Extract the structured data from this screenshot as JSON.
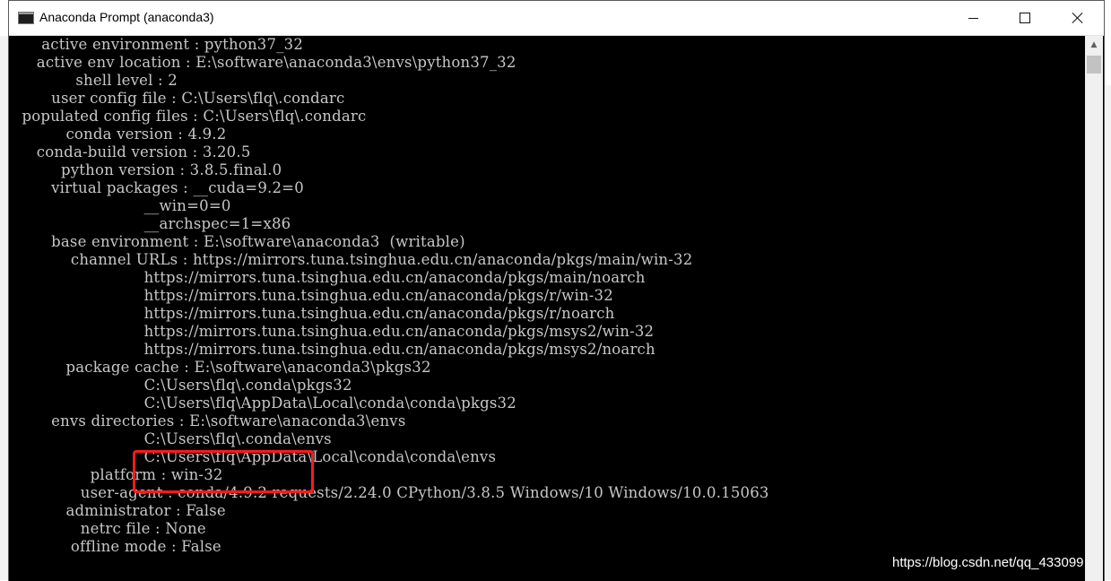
{
  "window": {
    "title": "Anaconda Prompt (anaconda3)"
  },
  "console": {
    "lines": [
      "     active environment : python37_32",
      "    active env location : E:\\software\\anaconda3\\envs\\python37_32",
      "            shell level : 2",
      "       user config file : C:\\Users\\flq\\.condarc",
      " populated config files : C:\\Users\\flq\\.condarc",
      "          conda version : 4.9.2",
      "    conda-build version : 3.20.5",
      "         python version : 3.8.5.final.0",
      "       virtual packages : __cuda=9.2=0",
      "                          __win=0=0",
      "                          __archspec=1=x86",
      "       base environment : E:\\software\\anaconda3  (writable)",
      "           channel URLs : https://mirrors.tuna.tsinghua.edu.cn/anaconda/pkgs/main/win-32",
      "                          https://mirrors.tuna.tsinghua.edu.cn/anaconda/pkgs/main/noarch",
      "                          https://mirrors.tuna.tsinghua.edu.cn/anaconda/pkgs/r/win-32",
      "                          https://mirrors.tuna.tsinghua.edu.cn/anaconda/pkgs/r/noarch",
      "                          https://mirrors.tuna.tsinghua.edu.cn/anaconda/pkgs/msys2/win-32",
      "                          https://mirrors.tuna.tsinghua.edu.cn/anaconda/pkgs/msys2/noarch",
      "          package cache : E:\\software\\anaconda3\\pkgs32",
      "                          C:\\Users\\flq\\.conda\\pkgs32",
      "                          C:\\Users\\flq\\AppData\\Local\\conda\\conda\\pkgs32",
      "       envs directories : E:\\software\\anaconda3\\envs",
      "                          C:\\Users\\flq\\.conda\\envs",
      "                          C:\\Users\\flq\\AppData\\Local\\conda\\conda\\envs",
      "               platform : win-32",
      "             user-agent : conda/4.9.2 requests/2.24.0 CPython/3.8.5 Windows/10 Windows/10.0.15063",
      "          administrator : False",
      "             netrc file : None",
      "           offline mode : False"
    ]
  },
  "watermark": "https://blog.csdn.net/qq_433099",
  "colors": {
    "console_bg": "#000000",
    "console_text": "#c7c7c7",
    "highlight": "#ff1a1a"
  },
  "icons": {
    "app": "console-icon",
    "minimize": "minimize-icon",
    "maximize": "maximize-icon",
    "close": "close-icon"
  }
}
